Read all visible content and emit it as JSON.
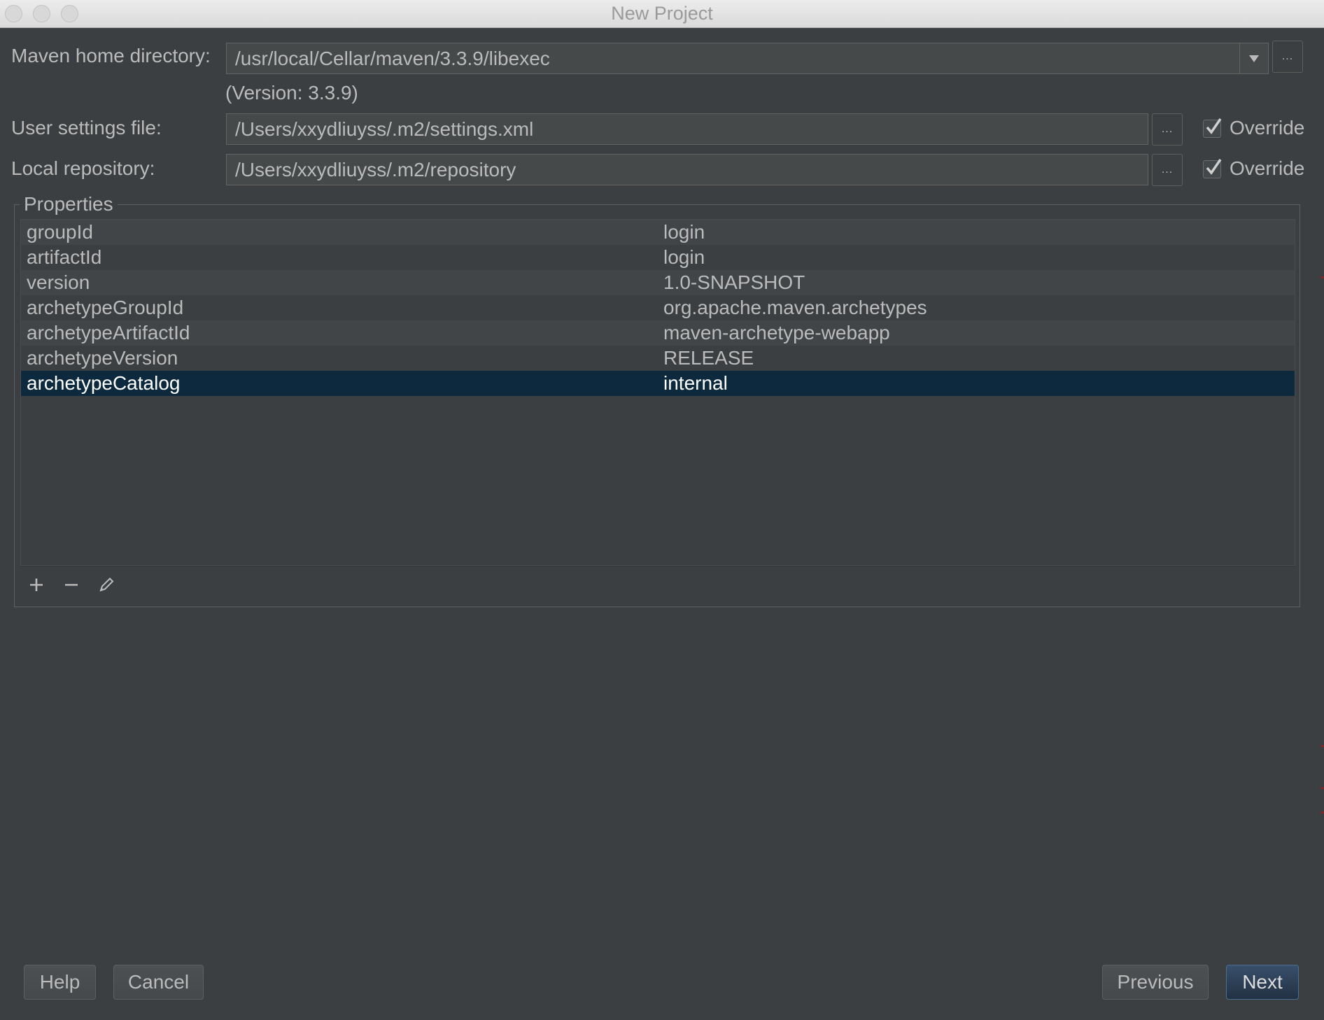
{
  "window": {
    "title": "New Project"
  },
  "maven_home": {
    "label": "Maven home directory:",
    "value": "/usr/local/Cellar/maven/3.3.9/libexec",
    "version_text": "(Version: 3.3.9)",
    "browse_label": "..."
  },
  "user_settings": {
    "label": "User settings file:",
    "value": "/Users/xxydliuyss/.m2/settings.xml",
    "browse_label": "...",
    "override_label": "Override",
    "override_checked": true
  },
  "local_repository": {
    "label": "Local repository:",
    "value": "/Users/xxydliuyss/.m2/repository",
    "browse_label": "...",
    "override_label": "Override",
    "override_checked": true
  },
  "properties": {
    "title": "Properties",
    "rows": [
      {
        "key": "groupId",
        "value": "login"
      },
      {
        "key": "artifactId",
        "value": "login"
      },
      {
        "key": "version",
        "value": "1.0-SNAPSHOT"
      },
      {
        "key": "archetypeGroupId",
        "value": "org.apache.maven.archetypes"
      },
      {
        "key": "archetypeArtifactId",
        "value": "maven-archetype-webapp"
      },
      {
        "key": "archetypeVersion",
        "value": "RELEASE"
      },
      {
        "key": "archetypeCatalog",
        "value": "internal"
      }
    ],
    "selected_row": "archetypeCatalog",
    "toolbar": [
      "add-icon",
      "remove-icon",
      "edit-icon"
    ]
  },
  "buttons": {
    "help": "Help",
    "cancel": "Cancel",
    "previous": "Previous",
    "next": "Next"
  },
  "colors": {
    "background": "#3c3f41",
    "selection": "#0d293e",
    "text": "#bbbbbb"
  }
}
